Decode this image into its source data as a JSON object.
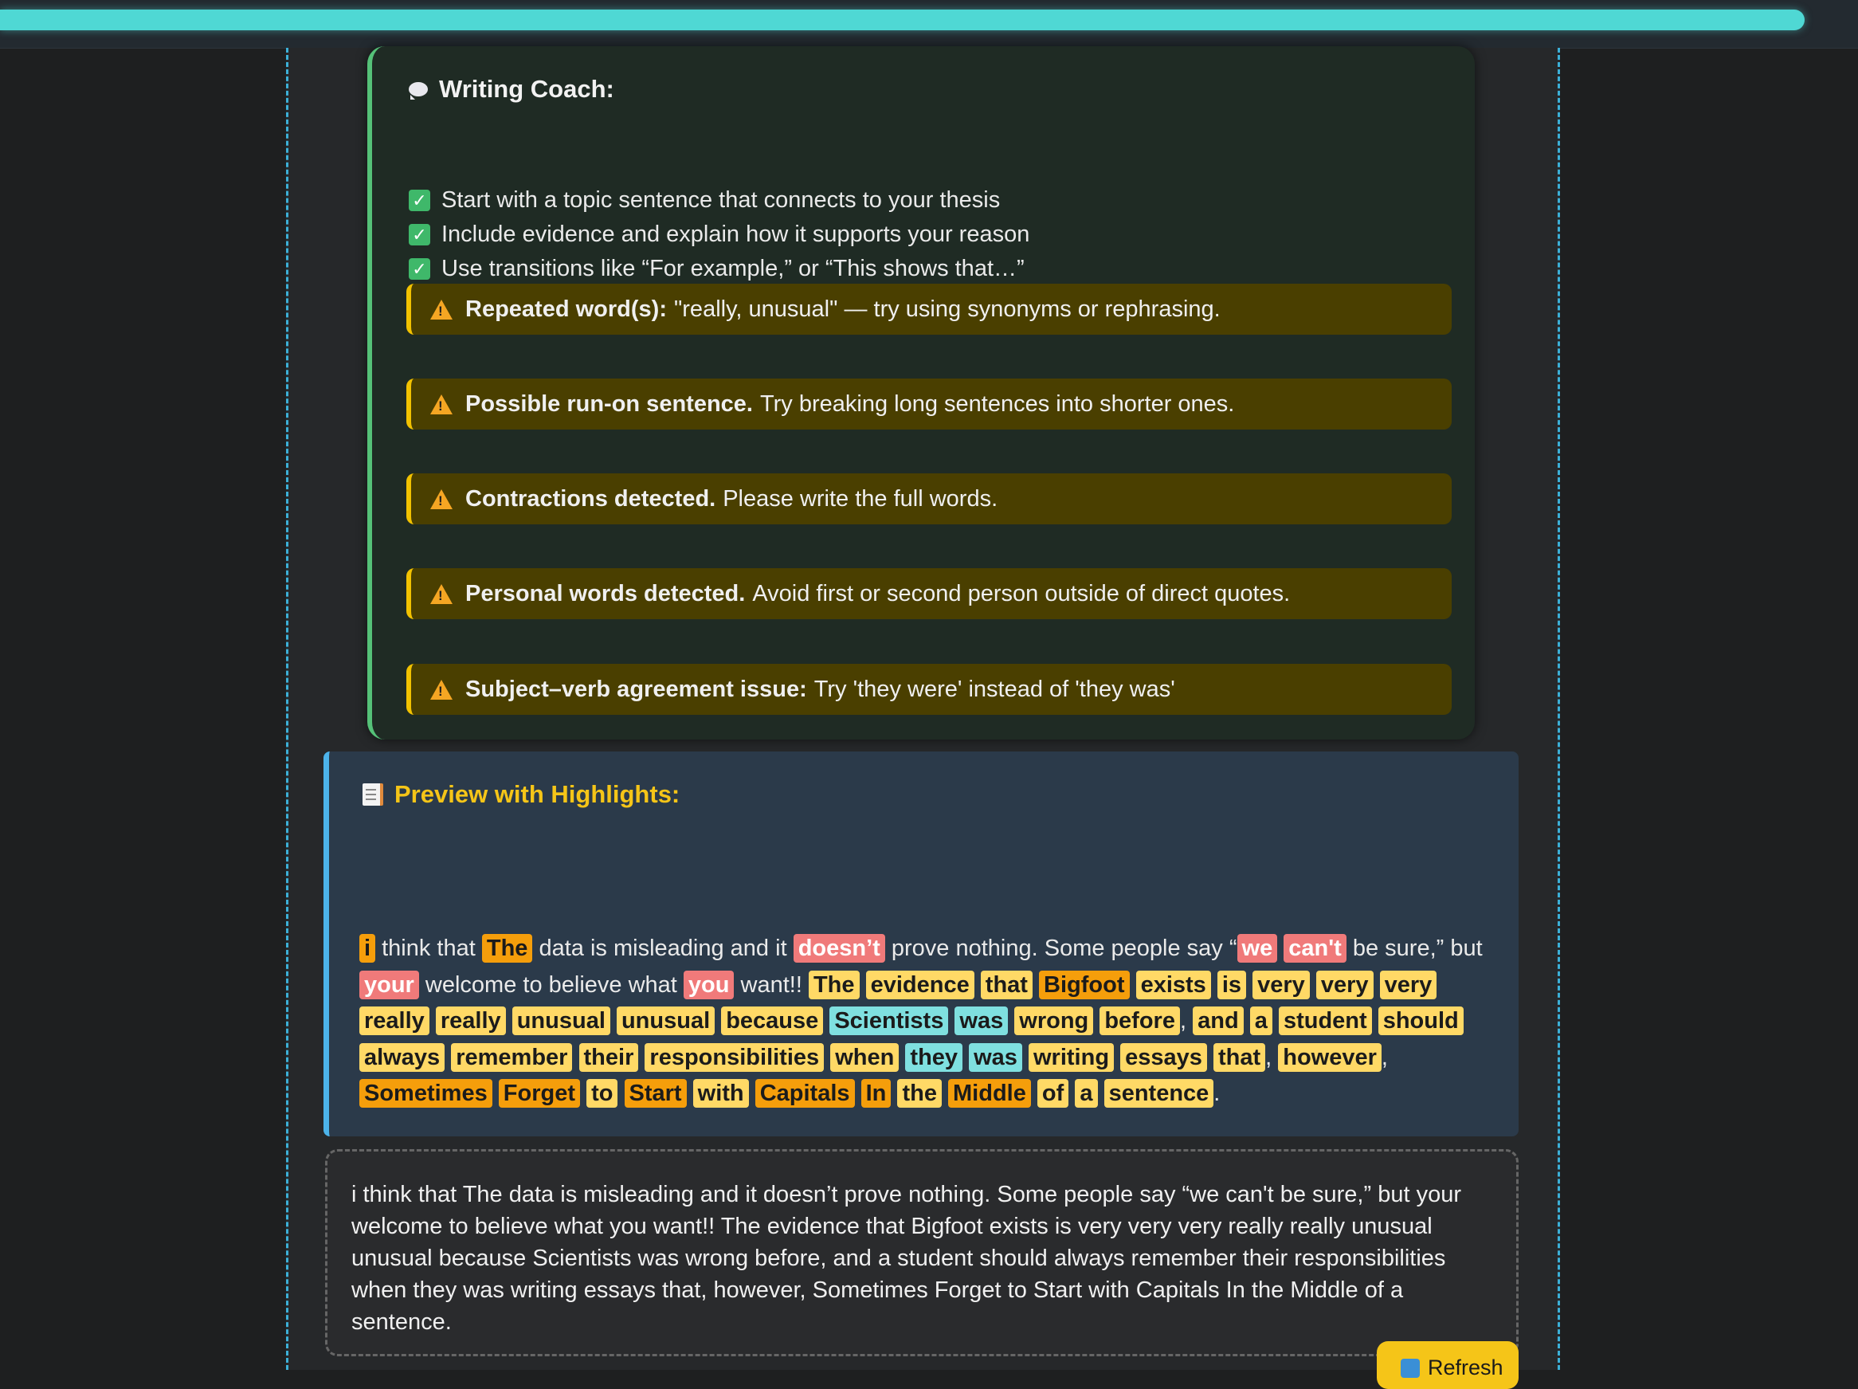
{
  "progress": {
    "value_percent": 97
  },
  "coach": {
    "icon": "speech-bubble-icon",
    "title": "Writing Coach:",
    "checklist": [
      "Start with a topic sentence that connects to your thesis",
      "Include evidence and explain how it supports your reason",
      "Use transitions like “For example,” or “This shows that…”"
    ],
    "alerts": [
      {
        "label": "Repeated word(s):",
        "text": "\"really, unusual\" — try using synonyms or rephrasing."
      },
      {
        "label": "Possible run-on sentence.",
        "text": "Try breaking long sentences into shorter ones."
      },
      {
        "label": "Contractions detected.",
        "text": "Please write the full words."
      },
      {
        "label": "Personal words detected.",
        "text": "Avoid first or second person outside of direct quotes."
      },
      {
        "label": "Subject–verb agreement issue:",
        "text": "Try 'they were' instead of 'they was'"
      }
    ]
  },
  "preview": {
    "icon": "memo-icon",
    "title": "Preview with Highlights:",
    "tokens": [
      {
        "t": "i",
        "c": "orange"
      },
      {
        "t": " think that "
      },
      {
        "t": "The",
        "c": "orange"
      },
      {
        "t": " data is misleading and it "
      },
      {
        "t": "doesn’t",
        "c": "red"
      },
      {
        "t": " prove nothing. Some people say “"
      },
      {
        "t": "we",
        "c": "red"
      },
      {
        "t": " "
      },
      {
        "t": "can't",
        "c": "red"
      },
      {
        "t": " be sure,” but "
      },
      {
        "t": "your",
        "c": "red"
      },
      {
        "t": " welcome to believe what "
      },
      {
        "t": "you",
        "c": "red"
      },
      {
        "t": " want!! "
      },
      {
        "t": "The",
        "c": "yellow"
      },
      {
        "t": " "
      },
      {
        "t": "evidence",
        "c": "yellow"
      },
      {
        "t": " "
      },
      {
        "t": "that",
        "c": "yellow"
      },
      {
        "t": " "
      },
      {
        "t": "Bigfoot",
        "c": "orange"
      },
      {
        "t": " "
      },
      {
        "t": "exists",
        "c": "yellow"
      },
      {
        "t": " "
      },
      {
        "t": "is",
        "c": "yellow"
      },
      {
        "t": " "
      },
      {
        "t": "very",
        "c": "yellow"
      },
      {
        "t": " "
      },
      {
        "t": "very",
        "c": "yellow"
      },
      {
        "t": " "
      },
      {
        "t": "very",
        "c": "yellow"
      },
      {
        "t": " "
      },
      {
        "t": "really",
        "c": "yellow"
      },
      {
        "t": " "
      },
      {
        "t": "really",
        "c": "yellow"
      },
      {
        "t": " "
      },
      {
        "t": "unusual",
        "c": "yellow"
      },
      {
        "t": " "
      },
      {
        "t": "unusual",
        "c": "yellow"
      },
      {
        "t": " "
      },
      {
        "t": "because",
        "c": "yellow"
      },
      {
        "t": " "
      },
      {
        "t": "Scientists",
        "c": "teal"
      },
      {
        "t": " "
      },
      {
        "t": "was",
        "c": "teal"
      },
      {
        "t": " "
      },
      {
        "t": "wrong",
        "c": "yellow"
      },
      {
        "t": " "
      },
      {
        "t": "before",
        "c": "yellow"
      },
      {
        "t": ", "
      },
      {
        "t": "and",
        "c": "yellow"
      },
      {
        "t": " "
      },
      {
        "t": "a",
        "c": "yellow"
      },
      {
        "t": " "
      },
      {
        "t": "student",
        "c": "yellow"
      },
      {
        "t": " "
      },
      {
        "t": "should",
        "c": "yellow"
      },
      {
        "t": " "
      },
      {
        "t": "always",
        "c": "yellow"
      },
      {
        "t": " "
      },
      {
        "t": "remember",
        "c": "yellow"
      },
      {
        "t": " "
      },
      {
        "t": "their",
        "c": "yellow"
      },
      {
        "t": " "
      },
      {
        "t": "responsibilities",
        "c": "yellow"
      },
      {
        "t": " "
      },
      {
        "t": "when",
        "c": "yellow"
      },
      {
        "t": " "
      },
      {
        "t": "they",
        "c": "teal"
      },
      {
        "t": " "
      },
      {
        "t": "was",
        "c": "teal"
      },
      {
        "t": " "
      },
      {
        "t": "writing",
        "c": "yellow"
      },
      {
        "t": " "
      },
      {
        "t": "essays",
        "c": "yellow"
      },
      {
        "t": " "
      },
      {
        "t": "that",
        "c": "yellow"
      },
      {
        "t": ", "
      },
      {
        "t": "however",
        "c": "yellow"
      },
      {
        "t": ", "
      },
      {
        "t": "Sometimes",
        "c": "orange"
      },
      {
        "t": " "
      },
      {
        "t": "Forget",
        "c": "orange"
      },
      {
        "t": " "
      },
      {
        "t": "to",
        "c": "yellow"
      },
      {
        "t": " "
      },
      {
        "t": "Start",
        "c": "orange"
      },
      {
        "t": " "
      },
      {
        "t": "with",
        "c": "yellow"
      },
      {
        "t": " "
      },
      {
        "t": "Capitals",
        "c": "orange"
      },
      {
        "t": " "
      },
      {
        "t": "In",
        "c": "orange"
      },
      {
        "t": " "
      },
      {
        "t": "the",
        "c": "yellow"
      },
      {
        "t": " "
      },
      {
        "t": "Middle",
        "c": "orange"
      },
      {
        "t": " "
      },
      {
        "t": "of",
        "c": "yellow"
      },
      {
        "t": " "
      },
      {
        "t": "a",
        "c": "yellow"
      },
      {
        "t": " "
      },
      {
        "t": "sentence",
        "c": "yellow"
      },
      {
        "t": "."
      }
    ]
  },
  "editor": {
    "value": "i think that The data is misleading and it doesn’t prove nothing. Some people say “we can't be sure,” but your welcome to believe what you want!! The evidence that Bigfoot exists is very very very really really unusual unusual because Scientists was wrong before, and a student should always remember their responsibilities when they was writing essays that, however, Sometimes Forget to Start with Capitals In the Middle of a sentence."
  },
  "refresh_button": {
    "icon": "refresh-icon",
    "label": "Refresh"
  },
  "colors": {
    "accent_teal": "#4fd8d4",
    "coach_border": "#55c178",
    "alert_bg": "#4a3f00",
    "alert_border": "#f2c200",
    "preview_border": "#4cb3ea",
    "preview_title": "#f5c518",
    "highlight_yellow": "#ffd966",
    "highlight_orange": "#f59e0b",
    "highlight_red": "#f07a7a",
    "highlight_teal": "#7fe0e0"
  }
}
